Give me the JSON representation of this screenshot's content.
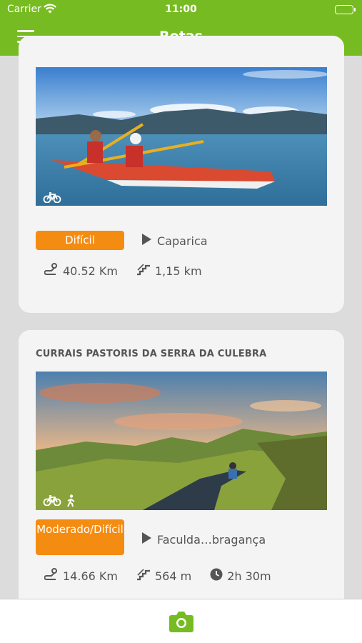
{
  "status": {
    "carrier": "Carrier",
    "time": "11:00"
  },
  "header": {
    "title": "Rotas"
  },
  "routes": [
    {
      "title": "",
      "difficulty": "Difícil",
      "start": "Caparica",
      "distance": "40.52 Km",
      "elevation": "1,15 km",
      "activities": [
        "bike-icon"
      ]
    },
    {
      "title": "CURRAIS PASTORIS DA SERRA DA CULEBRA",
      "difficulty": "Moderado/Difícil",
      "start": "Faculda…bragança",
      "distance": "14.66 Km",
      "elevation": "564 m",
      "duration": "2h 30m",
      "activities": [
        "bike-icon",
        "walk-icon"
      ]
    }
  ],
  "colors": {
    "accent": "#77bb22",
    "badge": "#f58c12"
  }
}
